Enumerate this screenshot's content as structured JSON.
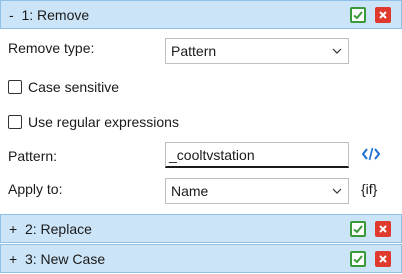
{
  "panels": [
    {
      "title": "-  1: Remove",
      "ok_icon": "check-icon",
      "delete_icon": "close-icon"
    },
    {
      "title": "+  2: Replace",
      "ok_icon": "check-icon",
      "delete_icon": "close-icon"
    },
    {
      "title": "+  3: New Case",
      "ok_icon": "check-icon",
      "delete_icon": "close-icon"
    }
  ],
  "remove": {
    "remove_type_label": "Remove type:",
    "remove_type_value": "Pattern",
    "case_sensitive_label": "Case sensitive",
    "case_sensitive_checked": false,
    "regex_label": "Use regular expressions",
    "regex_checked": false,
    "pattern_label": "Pattern:",
    "pattern_value": "_cooltvstation",
    "pattern_icon": "code-icon",
    "apply_to_label": "Apply to:",
    "apply_to_value": "Name",
    "if_label": "{if}"
  },
  "colors": {
    "header_bg": "#cce4f7",
    "ok_green": "#3a9a3a",
    "delete_red": "#e03a2e",
    "code_blue": "#1e6fd0"
  }
}
